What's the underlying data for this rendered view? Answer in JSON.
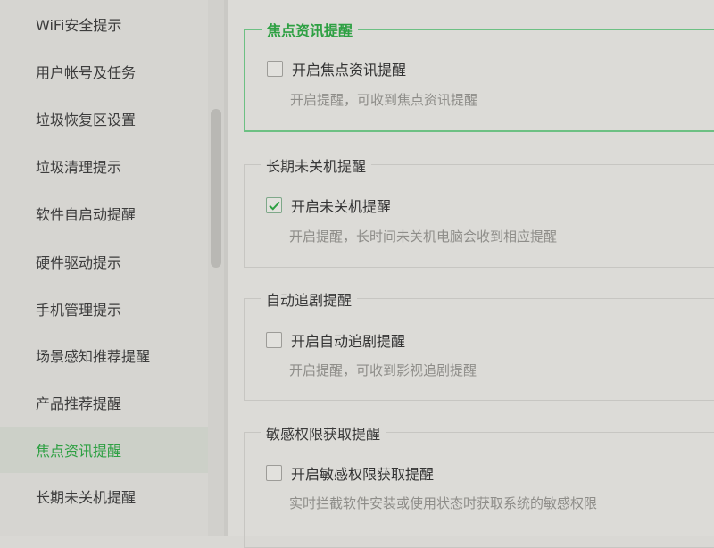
{
  "sidebar": {
    "items": [
      {
        "label": "WiFi安全提示"
      },
      {
        "label": "用户帐号及任务"
      },
      {
        "label": "垃圾恢复区设置"
      },
      {
        "label": "垃圾清理提示"
      },
      {
        "label": "软件自启动提醒"
      },
      {
        "label": "硬件驱动提示"
      },
      {
        "label": "手机管理提示"
      },
      {
        "label": "场景感知推荐提醒"
      },
      {
        "label": "产品推荐提醒"
      },
      {
        "label": "焦点资讯提醒",
        "active": true
      },
      {
        "label": "长期未关机提醒"
      }
    ]
  },
  "groups": [
    {
      "title": "焦点资讯提醒",
      "option": "开启焦点资讯提醒",
      "checked": false,
      "desc": "开启提醒，可收到焦点资讯提醒"
    },
    {
      "title": "长期未关机提醒",
      "option": "开启未关机提醒",
      "checked": true,
      "desc": "开启提醒，长时间未关机电脑会收到相应提醒"
    },
    {
      "title": "自动追剧提醒",
      "option": "开启自动追剧提醒",
      "checked": false,
      "desc": "开启提醒，可收到影视追剧提醒"
    },
    {
      "title": "敏感权限获取提醒",
      "option": "开启敏感权限获取提醒",
      "checked": false,
      "desc": "实时拦截软件安装或使用状态时获取系统的敏感权限"
    }
  ],
  "colors": {
    "accent": "#2ea043",
    "focus_border": "#6dc083"
  }
}
